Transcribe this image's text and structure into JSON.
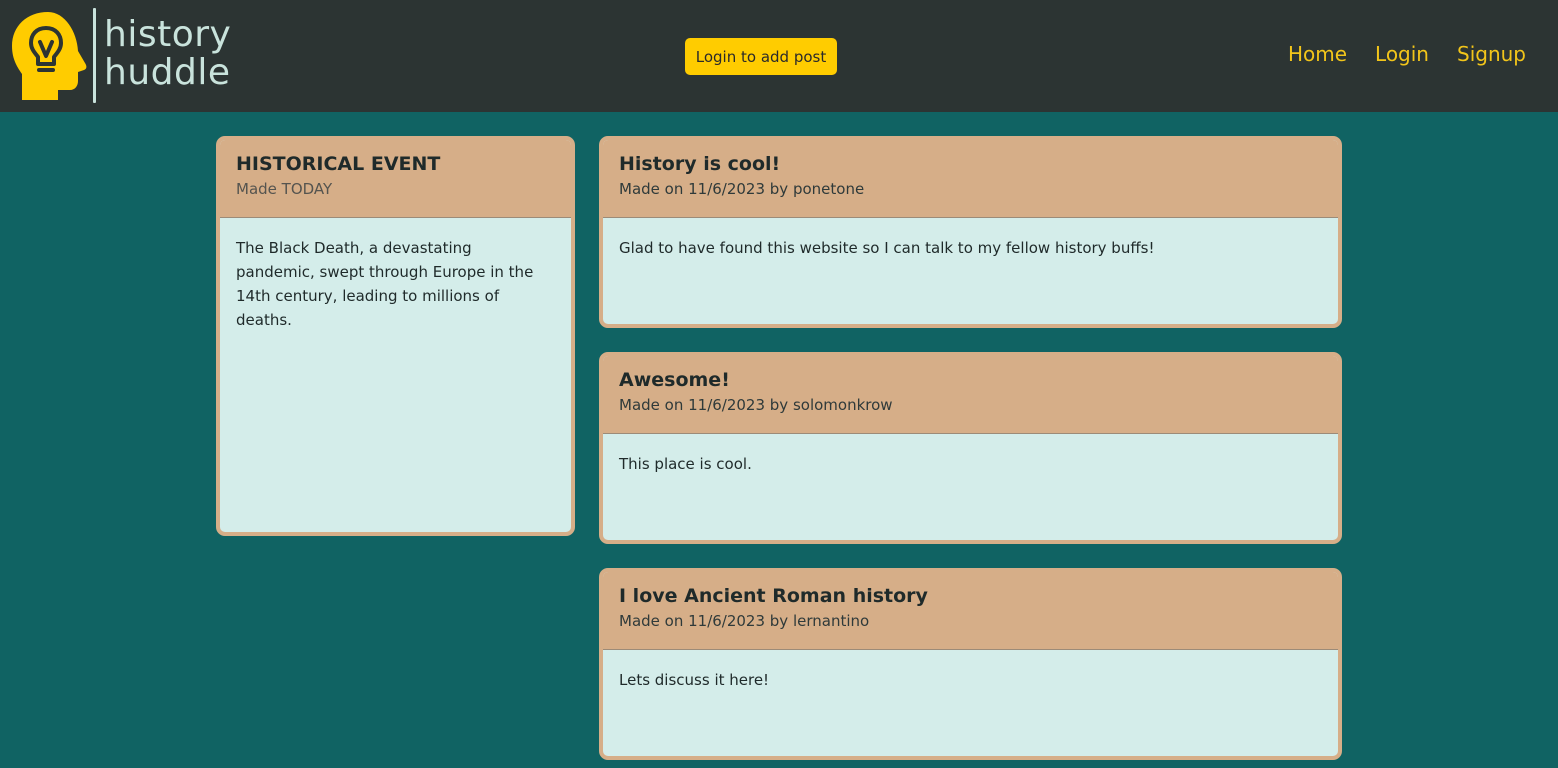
{
  "brand": {
    "line1": "history",
    "line2": "huddle",
    "icon": "lightbulb-head-icon",
    "accent": "#ffcc00"
  },
  "header": {
    "add_post_label": "Login to add post",
    "nav": [
      "Home",
      "Login",
      "Signup"
    ]
  },
  "event": {
    "title": "HISTORICAL EVENT",
    "subtitle": "Made TODAY",
    "body": "The Black Death, a devastating pandemic, swept through Europe in the 14th century, leading to millions of deaths."
  },
  "posts": [
    {
      "title": "History is cool!",
      "meta": "Made on 11/6/2023 by ponetone",
      "body": "Glad to have found this website so I can talk to my fellow history buffs!"
    },
    {
      "title": "Awesome!",
      "meta": "Made on 11/6/2023 by solomonkrow",
      "body": "This place is cool."
    },
    {
      "title": "I love Ancient Roman history",
      "meta": "Made on 11/6/2023 by lernantino",
      "body": "Lets discuss it here!"
    }
  ],
  "colors": {
    "page_bg": "#106363",
    "nav_bg": "#2c3433",
    "card_header": "#d6ae88",
    "card_body": "#d4edea",
    "nav_link": "#f2c51a"
  }
}
